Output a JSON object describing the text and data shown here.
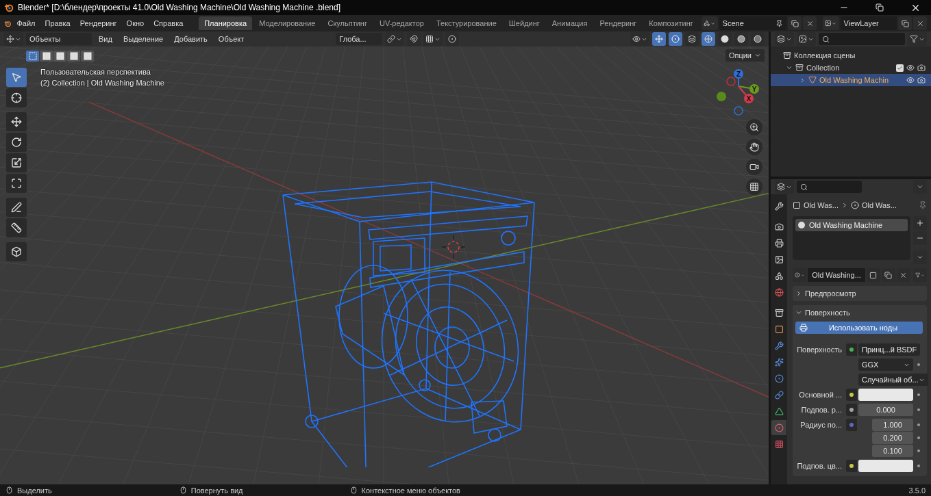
{
  "window": {
    "title": "Blender* [D:\\блендер\\проекты 41.0\\Old Washing Machine\\Old Washing Machine .blend]"
  },
  "menu_bar": {
    "menus": [
      "Файл",
      "Правка",
      "Рендеринг",
      "Окно",
      "Справка"
    ],
    "workspaces": [
      {
        "label": "Планировка",
        "selected": true
      },
      {
        "label": "Моделирование",
        "selected": false
      },
      {
        "label": "Скульптинг",
        "selected": false
      },
      {
        "label": "UV-редактор",
        "selected": false
      },
      {
        "label": "Текстурирование",
        "selected": false
      },
      {
        "label": "Шейдинг",
        "selected": false
      },
      {
        "label": "Анимация",
        "selected": false
      },
      {
        "label": "Рендеринг",
        "selected": false
      },
      {
        "label": "Композитинг",
        "selected": false
      }
    ],
    "scene": "Scene",
    "view_layer": "ViewLayer"
  },
  "viewport_header": {
    "mode": "Объекты",
    "menus": [
      "Вид",
      "Выделение",
      "Добавить",
      "Объект"
    ],
    "orientation": "Глоба...",
    "shading_modes": [
      {
        "kind": "wireframe",
        "selected": true
      },
      {
        "kind": "solid",
        "selected": false
      },
      {
        "kind": "material",
        "selected": false
      },
      {
        "kind": "rendered",
        "selected": false
      }
    ]
  },
  "select_modes": [
    {
      "selected": true
    },
    {
      "selected": false
    },
    {
      "selected": false
    },
    {
      "selected": false
    },
    {
      "selected": false
    }
  ],
  "options": "Опции",
  "tools": [
    {
      "kind": "select",
      "selected": true
    },
    {
      "kind": "cursor",
      "selected": false
    },
    {
      "kind": "move",
      "selected": false
    },
    {
      "kind": "rotate",
      "selected": false
    },
    {
      "kind": "scale",
      "selected": false
    },
    {
      "kind": "transform",
      "selected": false
    },
    {
      "kind": "annotate",
      "selected": false
    },
    {
      "kind": "measure",
      "selected": false
    },
    {
      "kind": "add",
      "selected": false
    }
  ],
  "viewport_info": [
    "Пользовательская перспектива",
    "(2) Collection | Old Washing Machine"
  ],
  "gizmo": {
    "axes": [
      {
        "label": "Z",
        "color": "#2f6fd6"
      },
      {
        "label": "Y",
        "color": "#6a9a1f"
      },
      {
        "label": "X",
        "color": "#d43a4c"
      }
    ]
  },
  "outliner": {
    "root": "Коллекция сцены",
    "collections": [
      {
        "label": "Collection",
        "expanded": true,
        "checked": true,
        "children": [
          {
            "label": "Old Washing Machin",
            "selected": true,
            "expanded": false
          }
        ]
      }
    ]
  },
  "properties": {
    "tabs": [
      {
        "kind": "tool",
        "selected": false
      },
      {
        "kind": "render",
        "selected": false
      },
      {
        "kind": "output",
        "selected": false
      },
      {
        "kind": "view-layer",
        "selected": false
      },
      {
        "kind": "scene",
        "selected": false
      },
      {
        "kind": "world",
        "selected": false
      },
      {
        "kind": "collection",
        "selected": false
      },
      {
        "kind": "object",
        "selected": false
      },
      {
        "kind": "modifier",
        "selected": false
      },
      {
        "kind": "particles",
        "selected": false
      },
      {
        "kind": "physics",
        "selected": false
      },
      {
        "kind": "constraint",
        "selected": false
      },
      {
        "kind": "data",
        "selected": false
      },
      {
        "kind": "material",
        "selected": true
      },
      {
        "kind": "texture",
        "selected": false
      }
    ],
    "breadcrumb": [
      "Old Was...",
      "Old Was..."
    ],
    "material_slots": [
      {
        "name": "Old Washing Machine",
        "selected": true
      }
    ],
    "material_name": "Old Washing...",
    "panels": [
      {
        "title": "Предпросмотр",
        "expanded": false
      },
      {
        "title": "Поверхность",
        "expanded": true
      }
    ],
    "use_nodes": "Использовать ноды",
    "fields": [
      {
        "kind": "link",
        "label": "Поверхность",
        "value": "Принц...й BSDF",
        "color": "#4caf50"
      },
      {
        "kind": "dropdown",
        "value": "GGX"
      },
      {
        "kind": "dropdown",
        "value": "Случайный об..."
      },
      {
        "kind": "color",
        "label": "Основной ...",
        "color": "#c7c74a"
      },
      {
        "kind": "number",
        "label": "Подпов. р...",
        "values": [
          "0.000"
        ],
        "color": "#a1a1a1"
      },
      {
        "kind": "number",
        "label": "Радиус по...",
        "values": [
          "1.000",
          "0.200",
          "0.100"
        ],
        "color": "#6363c7"
      },
      {
        "kind": "color",
        "label": "Подпов. цв...",
        "color": "#c7c74a"
      }
    ]
  },
  "status_bar": {
    "hints": [
      "Выделить",
      "Повернуть вид",
      "Контекстное меню объектов"
    ],
    "version": "3.5.0"
  }
}
